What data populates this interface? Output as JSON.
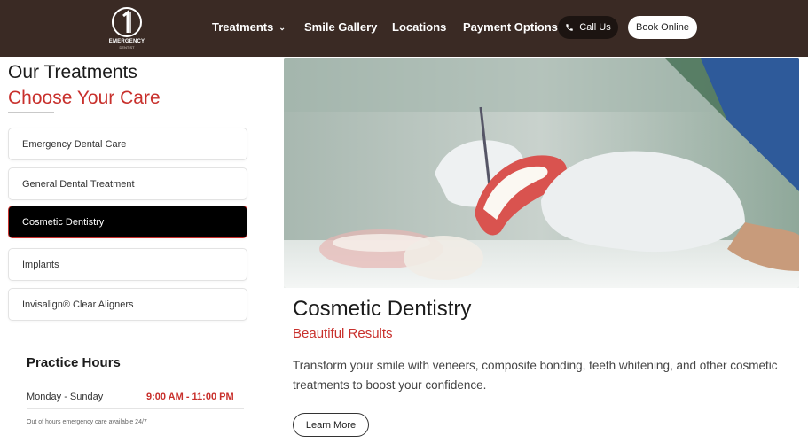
{
  "brand": {
    "logo_text": "EMERGENCY",
    "logo_sub": "DENTIST"
  },
  "nav": {
    "treatments": "Treatments",
    "smile_gallery": "Smile Gallery",
    "locations": "Locations",
    "payment_options": "Payment Options",
    "call_us": "Call Us",
    "book_online": "Book Online"
  },
  "sidebar": {
    "title": "Our Treatments",
    "subtitle": "Choose Your Care",
    "items": [
      {
        "label": "Emergency Dental Care"
      },
      {
        "label": "General Dental Treatment"
      },
      {
        "label": "Cosmetic Dentistry"
      },
      {
        "label": "Implants"
      },
      {
        "label": "Invisalign® Clear Aligners"
      }
    ],
    "active_item": "Cosmetic Dentistry",
    "hours": {
      "title": "Practice Hours",
      "day": "Monday - Sunday",
      "time": "9:00 AM - 11:00 PM",
      "note": "Out of hours emergency care available 24/7"
    }
  },
  "main": {
    "title": "Cosmetic Dentistry",
    "subtitle": "Beautiful Results",
    "description": "Transform your smile with veneers, composite bonding, teeth whitening, and other cosmetic treatments to boost your confidence.",
    "cta": "Learn More"
  },
  "colors": {
    "header_bg": "#3a2a24",
    "accent": "#c8302c",
    "active_bg": "#000000"
  }
}
